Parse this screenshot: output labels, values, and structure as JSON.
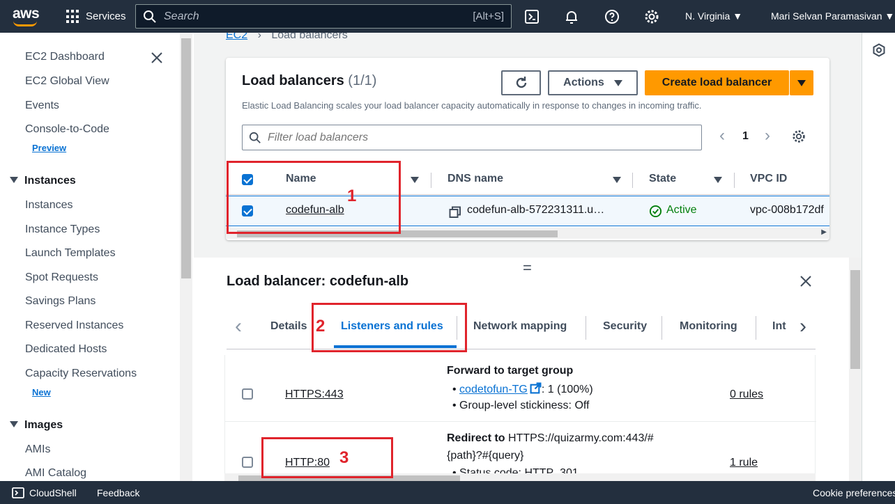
{
  "topnav": {
    "logo": "aws",
    "services": "Services",
    "search_placeholder": "Search",
    "search_shortcut": "[Alt+S]",
    "region": "N. Virginia",
    "user": "Mari Selvan Paramasivan"
  },
  "sidebar": {
    "items": [
      {
        "label": "EC2 Dashboard"
      },
      {
        "label": "EC2 Global View"
      },
      {
        "label": "Events"
      },
      {
        "label": "Console-to-Code",
        "badge": "Preview"
      }
    ],
    "instances_section": "Instances",
    "instances_items": [
      {
        "label": "Instances"
      },
      {
        "label": "Instance Types"
      },
      {
        "label": "Launch Templates"
      },
      {
        "label": "Spot Requests"
      },
      {
        "label": "Savings Plans"
      },
      {
        "label": "Reserved Instances"
      },
      {
        "label": "Dedicated Hosts"
      },
      {
        "label": "Capacity Reservations",
        "badge": "New"
      }
    ],
    "images_section": "Images",
    "images_items": [
      {
        "label": "AMIs"
      },
      {
        "label": "AMI Catalog"
      }
    ]
  },
  "breadcrumb": {
    "root": "EC2",
    "current": "Load balancers"
  },
  "lb_panel": {
    "title": "Load balancers",
    "count": "(1/1)",
    "description": "Elastic Load Balancing scales your load balancer capacity automatically in response to changes in incoming traffic.",
    "actions_label": "Actions",
    "create_label": "Create load balancer",
    "filter_placeholder": "Filter load balancers",
    "page_number": "1",
    "columns": [
      "Name",
      "DNS name",
      "State",
      "VPC ID"
    ],
    "row": {
      "name": "codefun-alb",
      "dns": "codefun-alb-572231311.u…",
      "state": "Active",
      "vpc": "vpc-008b172df"
    }
  },
  "detail": {
    "title": "Load balancer: codefun-alb",
    "tabs": [
      "Details",
      "Listeners and rules",
      "Network mapping",
      "Security",
      "Monitoring",
      "Int"
    ],
    "active_tab": "Listeners and rules",
    "listeners": [
      {
        "protocol": "HTTPS:443",
        "action_title": "Forward to target group",
        "target_group": "codetofun-TG",
        "target_weight": ": 1 (100%)",
        "stickiness": "Group-level stickiness: Off",
        "rules": "0 rules"
      },
      {
        "protocol": "HTTP:80",
        "action_bold": "Redirect to",
        "action_text": " HTTPS://quizarmy.com:443/#",
        "action_line2": "{path}?#{query}",
        "status": "Status code: HTTP_301",
        "rules": "1 rule"
      }
    ]
  },
  "footer": {
    "cloudshell": "CloudShell",
    "feedback": "Feedback",
    "cookie": "Cookie preferences"
  },
  "annotations": [
    "1",
    "2",
    "3"
  ],
  "colors": {
    "accent": "#0972d3",
    "primary_button": "#ff9900",
    "annotation": "#e0242c",
    "nav": "#232f3e",
    "active_state": "#037f0c"
  }
}
